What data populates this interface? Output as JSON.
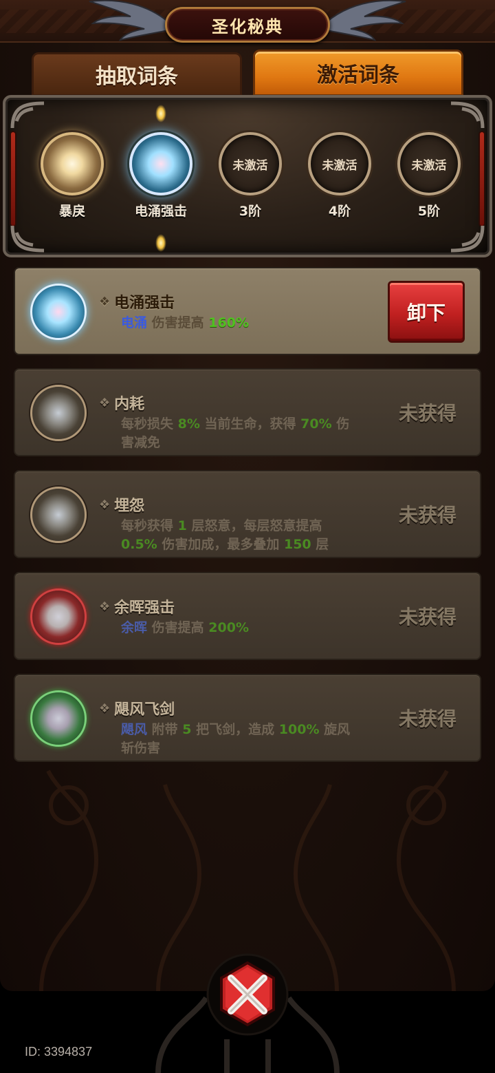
{
  "header": {
    "title": "圣化秘典"
  },
  "tabs": [
    {
      "label": "抽取词条",
      "active": false
    },
    {
      "label": "激活词条",
      "active": true
    }
  ],
  "tiers": [
    {
      "label": "暴戾",
      "state": "active",
      "orb": "gold"
    },
    {
      "label": "电涌强击",
      "state": "active",
      "orb": "electric"
    },
    {
      "label": "3阶",
      "state": "inactive",
      "orb_text": "未激活"
    },
    {
      "label": "4阶",
      "state": "inactive",
      "orb_text": "未激活"
    },
    {
      "label": "5阶",
      "state": "inactive",
      "orb_text": "未激活"
    }
  ],
  "cards": [
    {
      "title": "电涌强击",
      "desc": {
        "kw": "电涌",
        "t1": "伤害提高",
        "v1": "160%"
      },
      "action": "卸下",
      "orb": "electric"
    },
    {
      "title": "内耗",
      "desc": {
        "t1": "每秒损失",
        "v1": "8%",
        "t2": "当前生命，获得",
        "v2": "70%",
        "t3": "伤",
        "t4": "害减免"
      },
      "status": "未获得",
      "orb": "tan"
    },
    {
      "title": "埋怨",
      "desc": {
        "t1": "每秒获得",
        "v1": "1",
        "t2": "层怒意，每层怒意提高",
        "v2": "0.5%",
        "t3": "伤害加成，最多叠加",
        "v3": "150",
        "t4": "层"
      },
      "status": "未获得",
      "orb": "tan"
    },
    {
      "title": "余晖强击",
      "desc": {
        "kw": "余晖",
        "t1": "伤害提高",
        "v1": "200%"
      },
      "status": "未获得",
      "orb": "red"
    },
    {
      "title": "飓风飞剑",
      "desc": {
        "kw": "飓风",
        "t1": "附带",
        "v1": "5",
        "t2": "把飞剑，造成",
        "v2": "100%",
        "t3": "旋风",
        "t4": "斩伤害"
      },
      "status": "未获得",
      "orb": "green"
    }
  ],
  "footer": {
    "id": "ID: 3394837"
  },
  "colors": {
    "highlight_green": "#5ab82a",
    "highlight_blue": "#4a6ad8",
    "tab_active": "#e07812",
    "unload_button": "#c02020"
  }
}
